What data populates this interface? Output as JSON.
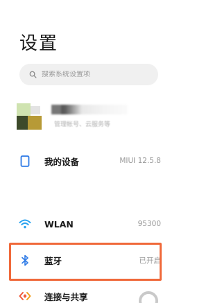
{
  "page": {
    "title": "设置"
  },
  "search": {
    "placeholder": "搜索系统设置项",
    "icon": "search-icon"
  },
  "account": {
    "avatar_icon": "avatar",
    "subtitle": "管理帐号、云服务等"
  },
  "rows": [
    {
      "icon": "device-icon",
      "label": "我的设备",
      "value": "MIUI 12.5.8",
      "icon_color": "#2f7be6"
    },
    {
      "icon": "wifi-icon",
      "label": "WLAN",
      "value": "95300",
      "icon_color": "#2aa3f0"
    },
    {
      "icon": "bluetooth-icon",
      "label": "蓝牙",
      "value": "已开启",
      "icon_color": "#2f7be6"
    },
    {
      "icon": "connection-share-icon",
      "label": "连接与共享",
      "value": "",
      "icon_color": "#f05a3a"
    }
  ],
  "colors": {
    "highlight": "#f0693a",
    "accent": "#2f7be6"
  }
}
